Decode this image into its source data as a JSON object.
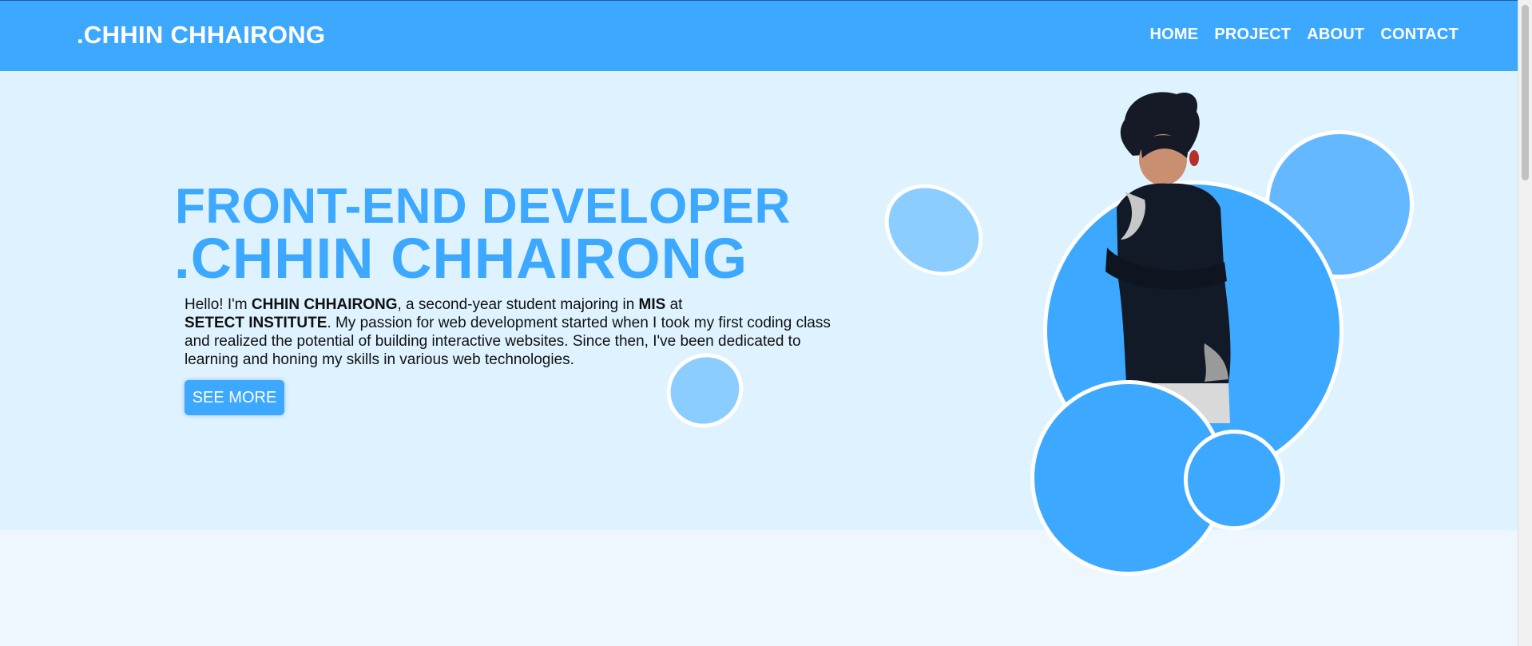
{
  "header": {
    "brand": ".CHHIN CHHAIRONG",
    "nav": [
      {
        "label": "HOME"
      },
      {
        "label": "PROJECT"
      },
      {
        "label": "ABOUT"
      },
      {
        "label": "CONTACT"
      }
    ]
  },
  "hero": {
    "subtitle": "FRONT-END DEVELOPER",
    "name": ".CHHIN CHHAIRONG",
    "intro": {
      "p1": "Hello! I'm ",
      "b1": "CHHIN CHHAIRONG",
      "p2": ", a second-year student majoring in ",
      "b2": "MIS",
      "p3": " at",
      "b3": "SETECT INSTITUTE",
      "p4": ". My passion for web development started when I took my first coding class and realized the potential of building interactive websites. Since then, I've been dedicated to learning and honing my skills in various web technologies."
    },
    "button_label": "SEE MORE",
    "portrait_icon": "person-photo"
  },
  "colors": {
    "primary": "#3ca8ff",
    "light_bubble": "#8ccdff",
    "hero_bg": "#def3ff",
    "page_bg": "#eef7ff"
  }
}
